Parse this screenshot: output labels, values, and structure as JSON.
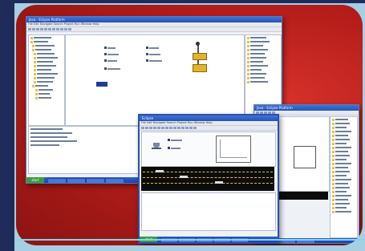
{
  "page": {
    "kind": "collage"
  },
  "window_a": {
    "title": "Java - Eclipse Platform",
    "menu": "File  Edit  Navigate  Search  Project  Run  Window  Help"
  },
  "window_b": {
    "title": "Eclipse",
    "menu": "File  Edit  Navigate  Search  Project  Run  Window  Help"
  },
  "window_c": {
    "title": "Java - Eclipse Platform"
  },
  "taskbar": {
    "start_label": "start"
  },
  "colors": {
    "panel_red": "#b51d1a",
    "navy": "#1f2c5a",
    "accent": "#e4b32a",
    "xp_blue": "#2453b8"
  }
}
